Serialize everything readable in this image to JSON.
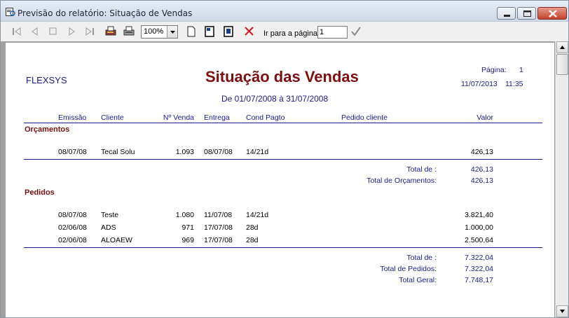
{
  "window": {
    "title": "Previsão do relatório: Situação de Vendas"
  },
  "toolbar": {
    "zoom_value": "100%",
    "goto_label": "Ir para a página",
    "goto_value": "1",
    "icons": [
      "first-page-icon",
      "prev-page-icon",
      "stop-icon",
      "next-page-icon",
      "last-page-icon",
      "print-setup-icon",
      "print-icon",
      "zoom-select",
      "page-width-icon",
      "one-page-icon",
      "two-pages-icon",
      "close-preview-icon",
      "go-check-icon"
    ]
  },
  "report": {
    "company": "FLEXSYS",
    "title": "Situação das Vendas",
    "period": "De 01/07/2008 à 31/07/2008",
    "page_label": "Página:",
    "page_number": "1",
    "print_date": "11/07/2013",
    "print_time": "11:35",
    "columns": [
      "Emissão",
      "Cliente",
      "Nº Venda",
      "Entrega",
      "Cond Pagto",
      "Pedido cliente",
      "Valor"
    ],
    "sections": [
      {
        "name": "Orçamentos",
        "rows": [
          {
            "emissao": "08/07/08",
            "cliente": "Tecal Solu",
            "venda": "1.093",
            "entrega": "08/07/08",
            "cond": "14/21d",
            "pedido": "",
            "valor": "426,13"
          }
        ],
        "total_label": "Total de :",
        "total_value": "426,13",
        "total_group_label": "Total de Orçamentos:",
        "total_group_value": "426,13"
      },
      {
        "name": "Pedidos",
        "rows": [
          {
            "emissao": "08/07/08",
            "cliente": "Teste",
            "venda": "1.080",
            "entrega": "11/07/08",
            "cond": "14/21d",
            "pedido": "",
            "valor": "3.821,40"
          },
          {
            "emissao": "02/06/08",
            "cliente": "ADS",
            "venda": "971",
            "entrega": "17/07/08",
            "cond": "28d",
            "pedido": "",
            "valor": "1.000,00"
          },
          {
            "emissao": "02/06/08",
            "cliente": "ALOAEW",
            "venda": "969",
            "entrega": "17/07/08",
            "cond": "28d",
            "pedido": "",
            "valor": "2.500,64"
          }
        ],
        "total_label": "Total de :",
        "total_value": "7.322,04",
        "total_group_label": "Total de Pedidos:",
        "total_group_value": "7.322,04"
      }
    ],
    "grand_total_label": "Total Geral:",
    "grand_total_value": "7.748,17"
  }
}
